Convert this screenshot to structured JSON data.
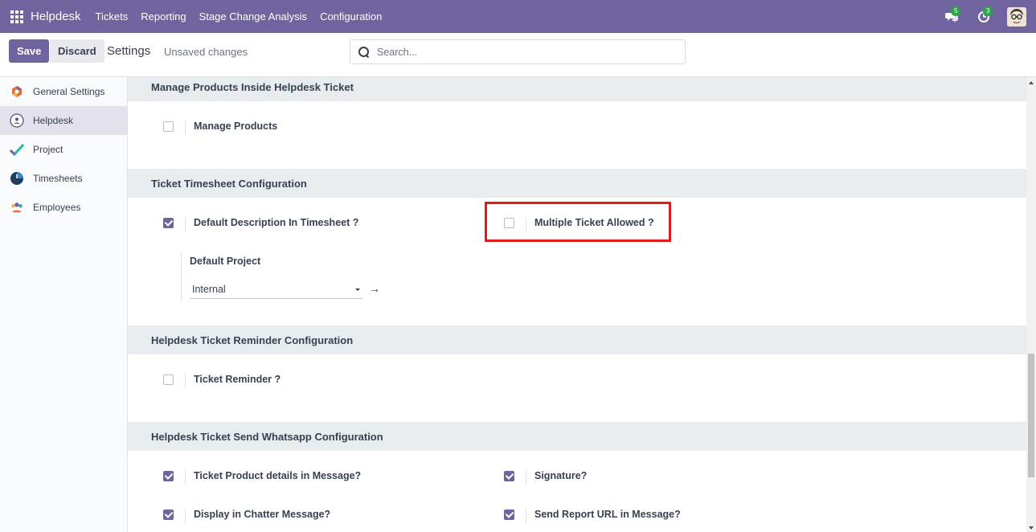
{
  "navbar": {
    "brand": "Helpdesk",
    "menus": [
      "Tickets",
      "Reporting",
      "Stage Change Analysis",
      "Configuration"
    ],
    "messages_badge": "5",
    "activities_badge": "3"
  },
  "control": {
    "save_label": "Save",
    "discard_label": "Discard",
    "title": "Settings",
    "status": "Unsaved changes",
    "search_placeholder": "Search..."
  },
  "sidebar": {
    "items": [
      {
        "label": "General Settings",
        "icon": "hexagon-icon"
      },
      {
        "label": "Helpdesk",
        "icon": "helpdesk-icon"
      },
      {
        "label": "Project",
        "icon": "checkmark-icon"
      },
      {
        "label": "Timesheets",
        "icon": "clock-icon"
      },
      {
        "label": "Employees",
        "icon": "people-icon"
      }
    ]
  },
  "sections": {
    "manage_products": {
      "title": "Manage Products Inside Helpdesk Ticket",
      "manage_products": {
        "label": "Manage Products",
        "checked": false
      }
    },
    "timesheet": {
      "title": "Ticket Timesheet Configuration",
      "default_description": {
        "label": "Default Description In Timesheet ?",
        "checked": true
      },
      "multiple_ticket": {
        "label": "Multiple Ticket Allowed ?",
        "checked": false
      },
      "default_project_label": "Default Project",
      "default_project_value": "Internal"
    },
    "reminder": {
      "title": "Helpdesk Ticket Reminder Configuration",
      "ticket_reminder": {
        "label": "Ticket Reminder ?",
        "checked": false
      }
    },
    "whatsapp": {
      "title": "Helpdesk Ticket Send Whatsapp Configuration",
      "product_details": {
        "label": "Ticket Product details in Message?",
        "checked": true
      },
      "signature": {
        "label": "Signature?",
        "checked": true
      },
      "chatter": {
        "label": "Display in Chatter Message?",
        "checked": true
      },
      "report_url": {
        "label": "Send Report URL in Message?",
        "checked": true
      }
    }
  },
  "colors": {
    "brand": "#71639e",
    "highlight": "#e11a1a",
    "badge": "#28a745"
  }
}
